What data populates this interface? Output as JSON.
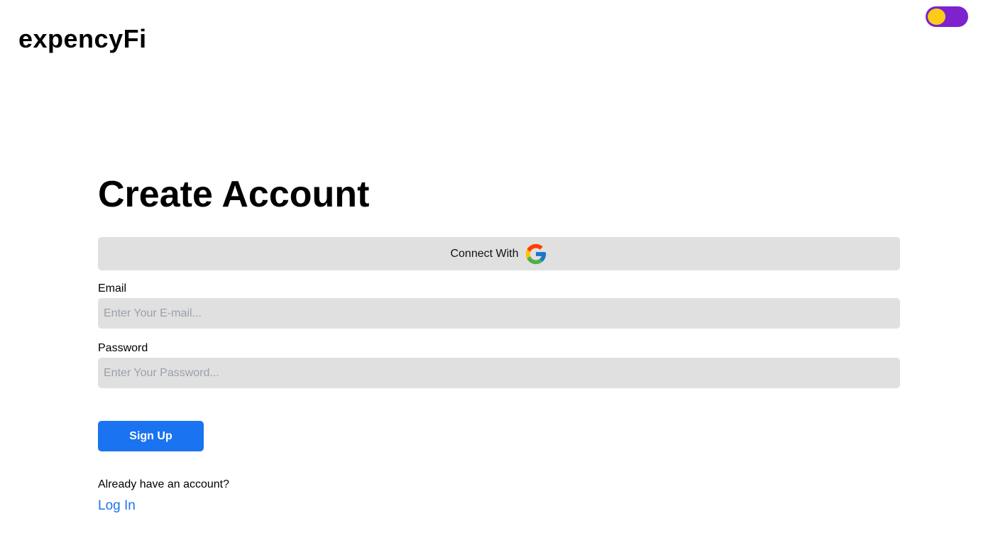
{
  "app": {
    "logo": "expencyFi"
  },
  "theme_toggle": {
    "state": "on",
    "track_color": "#7e22ce",
    "knob_color": "#facc15"
  },
  "form": {
    "title": "Create Account",
    "google_button_label": "Connect With",
    "google_icon": "google-icon",
    "email": {
      "label": "Email",
      "placeholder": "Enter Your E-mail...",
      "value": ""
    },
    "password": {
      "label": "Password",
      "placeholder": "Enter Your Password...",
      "value": ""
    },
    "submit_label": "Sign Up",
    "footer": {
      "prompt": "Already have an account?",
      "link": "Log In"
    }
  },
  "colors": {
    "accent": "#1a73f0",
    "input_bg": "#e0e0e0"
  }
}
